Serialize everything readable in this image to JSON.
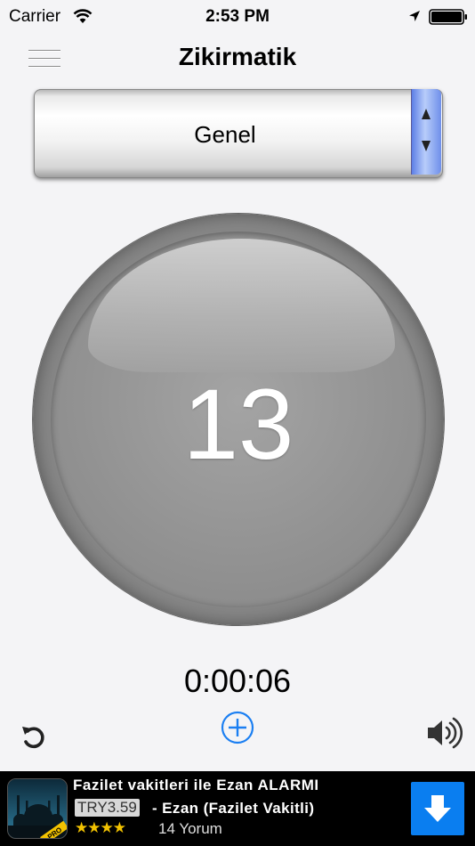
{
  "status_bar": {
    "carrier": "Carrier",
    "time": "2:53 PM",
    "icons": [
      "wifi-icon",
      "location-arrow-icon",
      "battery-icon"
    ]
  },
  "nav": {
    "title": "Zikirmatik",
    "menu_icon": "hamburger-menu-icon"
  },
  "picker": {
    "selected": "Genel",
    "icon": "up-down-spinner-icon"
  },
  "counter": {
    "value": "13"
  },
  "timer": {
    "elapsed": "0:00:06"
  },
  "controls": {
    "reset_icon": "reset-icon",
    "add_icon": "plus-circle-icon",
    "sound_icon": "speaker-icon"
  },
  "ad": {
    "title": "Fazilet vakitleri ile Ezan ALARMI",
    "price": "TRY3.59",
    "subtitle": "- Ezan (Fazilet Vakitli)",
    "stars": "★★★★",
    "rating": 4,
    "reviews": "14 Yorum",
    "icon_badge": "PRO",
    "download_icon": "download-arrow-icon"
  },
  "colors": {
    "background": "#f4f4f6",
    "counter_gray": "#8c8c8c",
    "accent_blue": "#0a7ef0",
    "ad_background": "#000000",
    "star_color": "#f2c200"
  }
}
